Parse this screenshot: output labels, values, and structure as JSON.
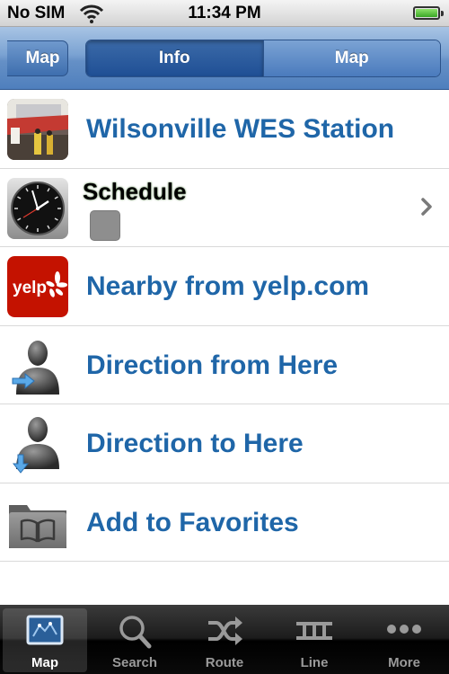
{
  "status_bar": {
    "carrier": "No SIM",
    "time": "11:34 PM"
  },
  "nav_bar": {
    "back_label": "Map",
    "segments": [
      {
        "label": "Info",
        "selected": true
      },
      {
        "label": "Map",
        "selected": false
      }
    ]
  },
  "rows": [
    {
      "label": "Wilsonville WES Station",
      "icon": "station-photo-icon"
    },
    {
      "label": "Schedule",
      "icon": "clock-icon"
    },
    {
      "label": "Nearby from yelp.com",
      "icon": "yelp-icon",
      "icon_text": "yelp"
    },
    {
      "label": "Direction from Here",
      "icon": "person-arrow-right-icon"
    },
    {
      "label": "Direction to Here",
      "icon": "person-arrow-down-icon"
    },
    {
      "label": "Add to Favorites",
      "icon": "folder-book-icon"
    }
  ],
  "tab_bar": {
    "tabs": [
      {
        "label": "Map",
        "icon": "map-icon",
        "selected": true
      },
      {
        "label": "Search",
        "icon": "magnifier-icon",
        "selected": false
      },
      {
        "label": "Route",
        "icon": "shuffle-icon",
        "selected": false
      },
      {
        "label": "Line",
        "icon": "rail-track-icon",
        "selected": false
      },
      {
        "label": "More",
        "icon": "dots-icon",
        "selected": false
      }
    ]
  },
  "colors": {
    "link_blue": "#1f66a8",
    "nav_blue": "#6590c6",
    "yelp_red": "#c41200",
    "swatch_gray": "#8e8e8e"
  }
}
